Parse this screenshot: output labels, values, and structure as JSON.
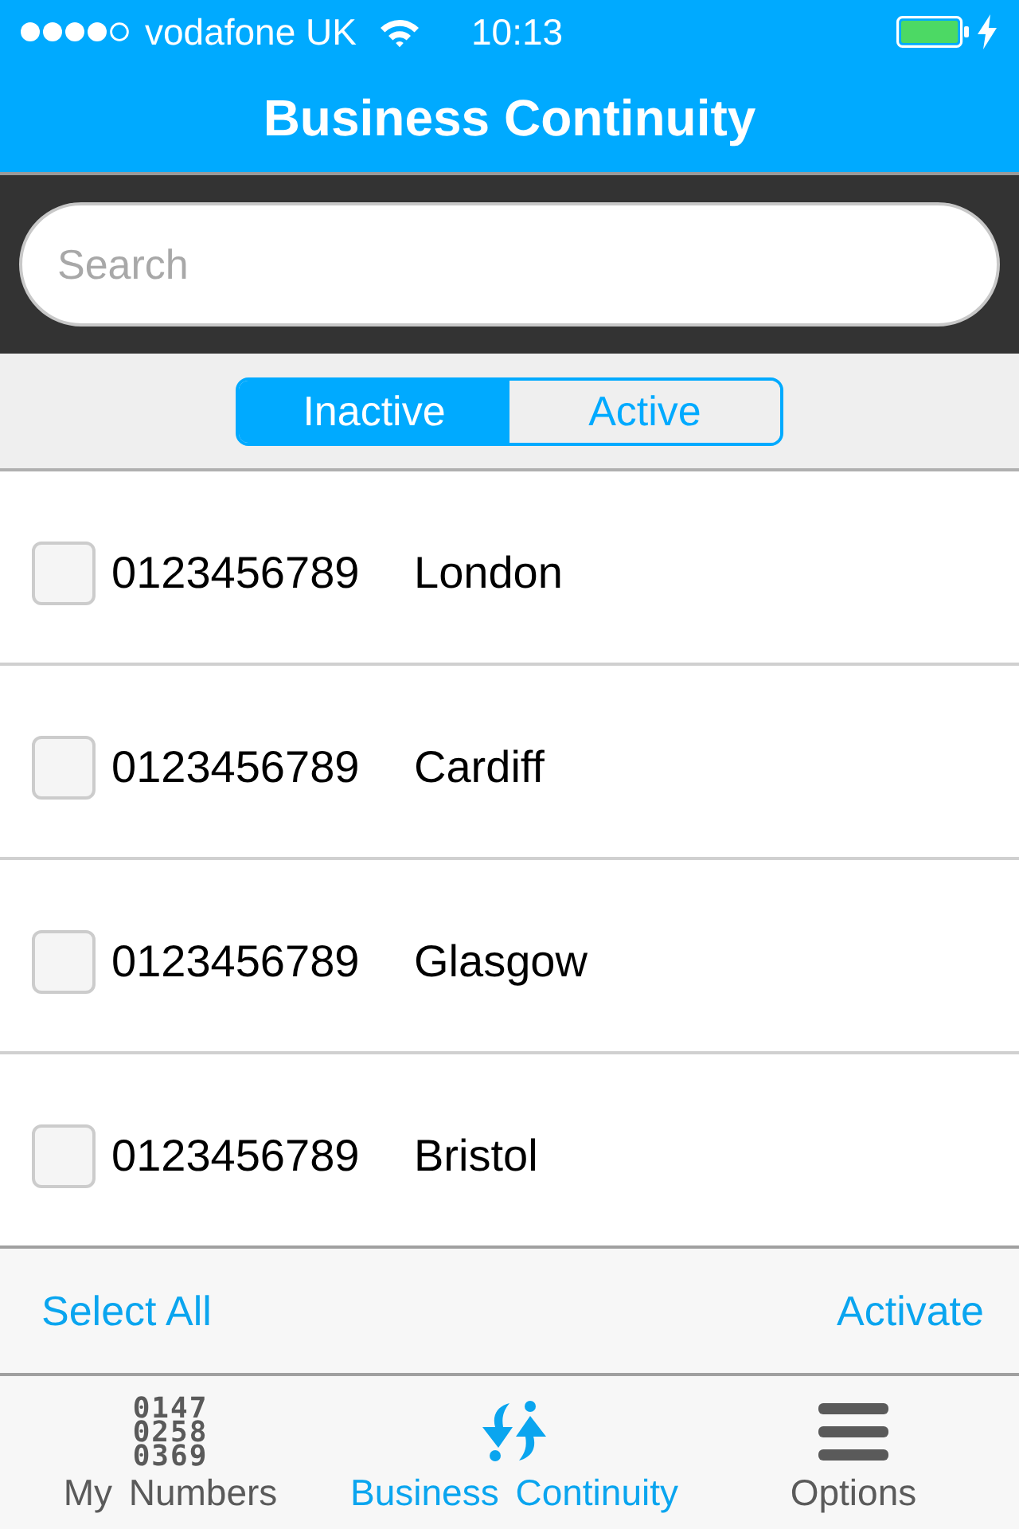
{
  "status_bar": {
    "carrier": "vodafone UK",
    "time": "10:13"
  },
  "nav_bar": {
    "title": "Business Continuity"
  },
  "search": {
    "placeholder": "Search"
  },
  "segments": [
    {
      "label": "Inactive",
      "selected": true
    },
    {
      "label": "Active",
      "selected": false
    }
  ],
  "rows": [
    {
      "number": "0123456789",
      "location": "London",
      "checked": false
    },
    {
      "number": "0123456789",
      "location": "Cardiff",
      "checked": false
    },
    {
      "number": "0123456789",
      "location": "Glasgow",
      "checked": false
    },
    {
      "number": "0123456789",
      "location": "Bristol",
      "checked": false
    }
  ],
  "toolbar": {
    "select_all": "Select All",
    "activate": "Activate"
  },
  "tab_bar": [
    {
      "kind": "digits",
      "icon_lines": [
        "0147",
        "0258",
        "0369"
      ],
      "label": "My Numbers",
      "selected": false
    },
    {
      "kind": "arrows",
      "label": "Business Continuity",
      "selected": true
    },
    {
      "kind": "menu",
      "label": "Options",
      "selected": false
    }
  ]
}
